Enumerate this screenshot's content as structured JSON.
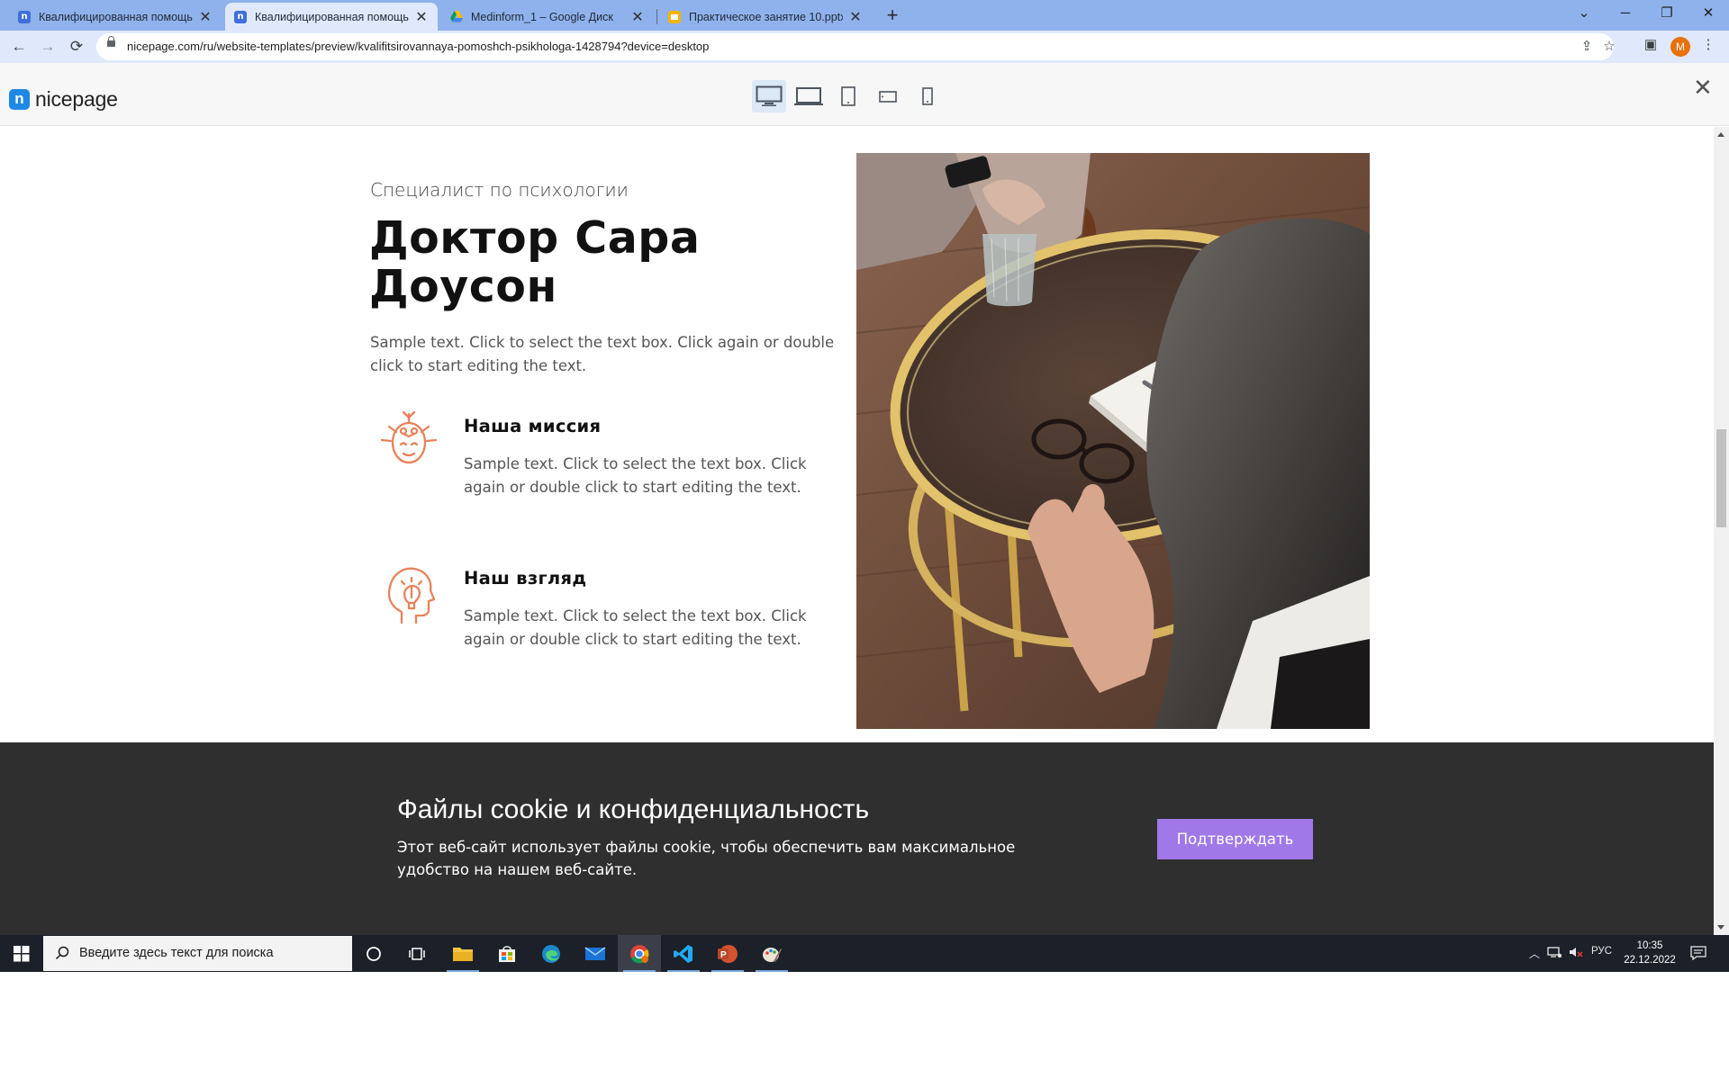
{
  "browser": {
    "tabs": [
      {
        "label": "Квалифицированная помощь п",
        "favicon": "nicepage-icon",
        "active": false
      },
      {
        "label": "Квалифицированная помощь п",
        "favicon": "nicepage-icon",
        "active": true
      },
      {
        "label": "Medinform_1 – Google Диск",
        "favicon": "google-drive-icon",
        "active": false
      },
      {
        "label": "Практическое занятие 10.pptx -",
        "favicon": "google-slides-icon",
        "active": false
      }
    ],
    "url": "nicepage.com/ru/website-templates/preview/kvalifitsirovannaya-pomoshch-psikhologa-1428794?device=desktop",
    "profile_initial": "M"
  },
  "preview_header": {
    "logo_text": "nicepage",
    "devices": [
      "desktop",
      "laptop",
      "tablet",
      "phone-landscape",
      "phone-portrait"
    ],
    "active_device": "desktop"
  },
  "content": {
    "eyebrow": "Специалист по психологии",
    "title": "Доктор Сара Доусон",
    "intro": "Sample text. Click to select the text box. Click again or double click to start editing the text.",
    "features": [
      {
        "icon": "mind-head-icon",
        "title": "Наша миссия",
        "text": "Sample text. Click to select the text box. Click again or double click to start editing the text."
      },
      {
        "icon": "idea-head-icon",
        "title": "Наш взгляд",
        "text": "Sample text. Click to select the text box. Click again or double click to start editing the text."
      }
    ],
    "accent_color": "#e8825a"
  },
  "cookie": {
    "title": "Файлы cookie и конфиденциальность",
    "text": "Этот веб-сайт использует файлы cookie, чтобы обеспечить вам максимальное удобство на нашем веб-сайте.",
    "button": "Подтверждать",
    "button_color": "#a078e8"
  },
  "taskbar": {
    "search_placeholder": "Введите здесь текст для поиска",
    "language": "РУС",
    "time": "10:35",
    "date": "22.12.2022"
  }
}
